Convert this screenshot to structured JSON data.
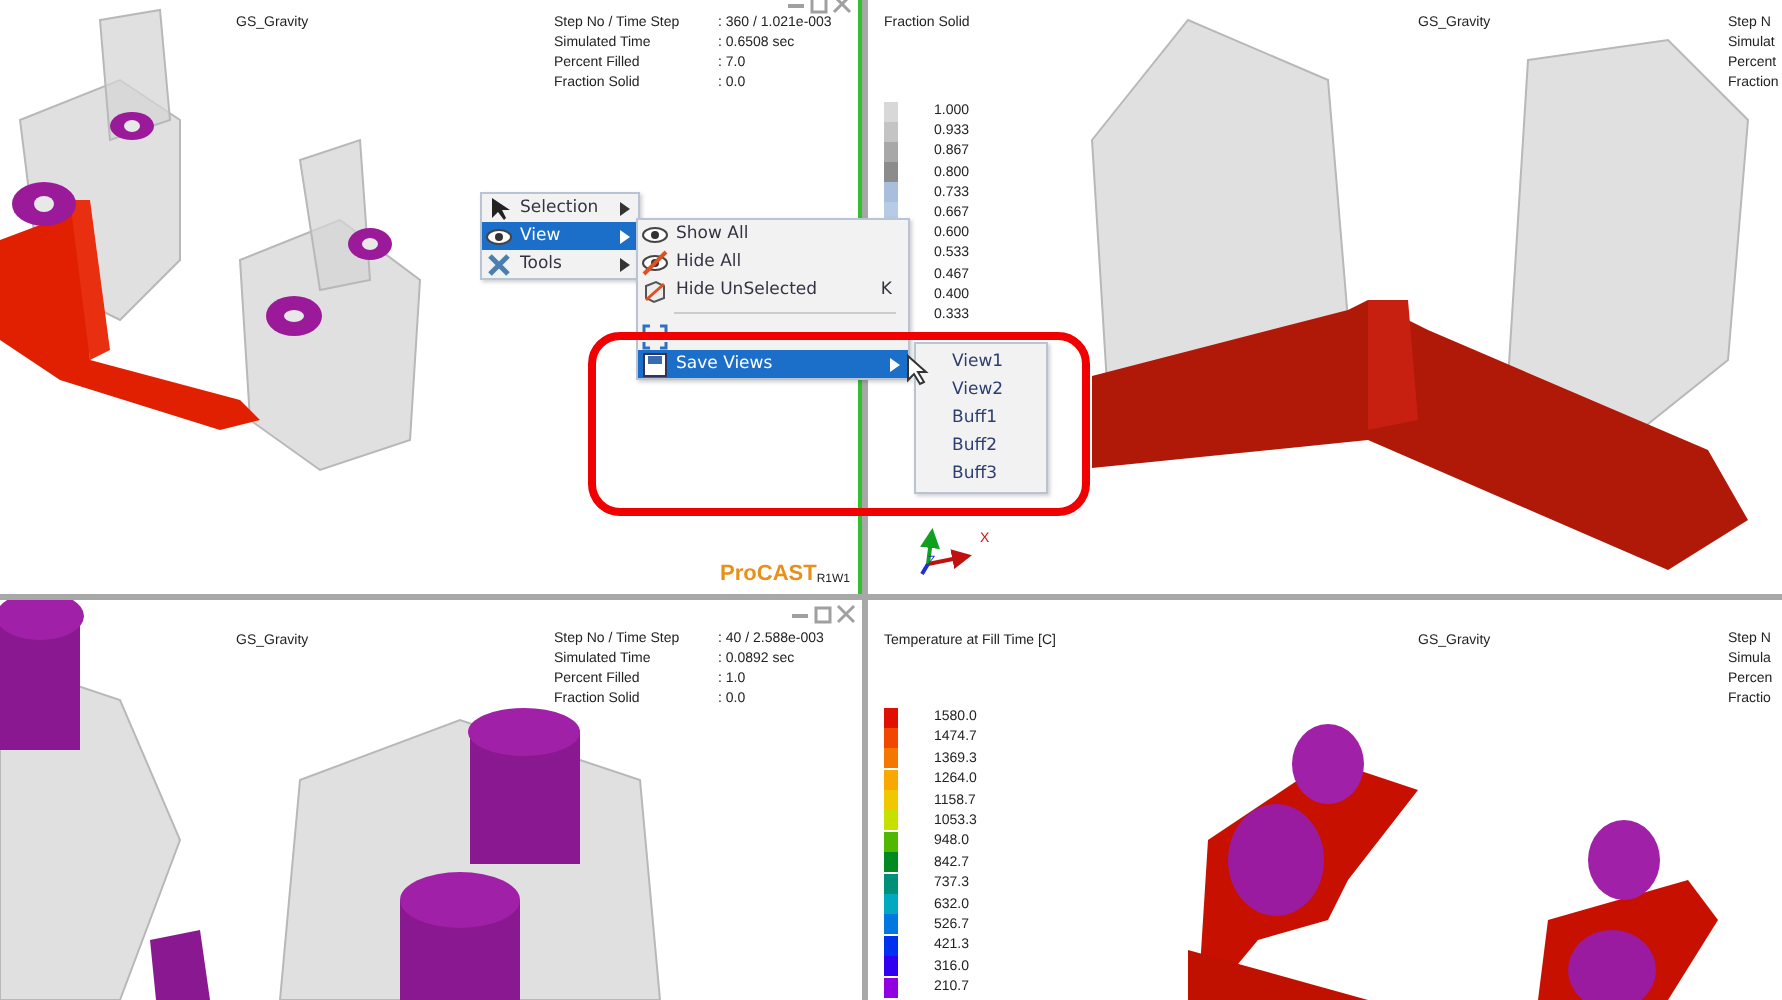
{
  "viewports": [
    {
      "kind": "fill",
      "active": true,
      "title": "GS_Gravity",
      "info": [
        {
          "label": "Step No / Time Step",
          "value": ": 360 / 1.021e-003"
        },
        {
          "label": "Simulated Time",
          "value": ": 0.6508 sec"
        },
        {
          "label": "Percent Filled",
          "value": ": 7.0"
        },
        {
          "label": "Fraction Solid",
          "value": ": 0.0"
        }
      ],
      "logo": "ProCAST",
      "logo_tag": "R1W1"
    },
    {
      "kind": "fraction",
      "active": false,
      "title": "GS_Gravity",
      "info": [
        {
          "label": "Step N"
        },
        {
          "label": "Simulat"
        },
        {
          "label": "Percent"
        },
        {
          "label": "Fraction"
        }
      ],
      "legend": {
        "title": "Fraction Solid",
        "items": [
          {
            "value": "1.000",
            "color": "#d8d8d8"
          },
          {
            "value": "0.933",
            "color": "#c4c4c4"
          },
          {
            "value": "0.867",
            "color": "#a8a8a8"
          },
          {
            "value": "0.800",
            "color": "#8c8c8c"
          },
          {
            "value": "0.733",
            "color": "#a9bedc"
          },
          {
            "value": "0.667",
            "color": "#b8cbe6"
          },
          {
            "value": "0.600"
          },
          {
            "value": "0.533"
          },
          {
            "value": "0.467"
          },
          {
            "value": "0.400"
          },
          {
            "value": "0.333"
          }
        ]
      },
      "axes": {
        "x": "X",
        "z": "Z"
      }
    },
    {
      "kind": "fill_zoom",
      "active": false,
      "title": "GS_Gravity",
      "info": [
        {
          "label": "Step No / Time Step",
          "value": ": 40 / 2.588e-003"
        },
        {
          "label": "Simulated Time",
          "value": ": 0.0892 sec"
        },
        {
          "label": "Percent Filled",
          "value": ": 1.0"
        },
        {
          "label": "Fraction Solid",
          "value": ": 0.0"
        }
      ]
    },
    {
      "kind": "temperature",
      "active": false,
      "title": "GS_Gravity",
      "info": [
        {
          "label": "Step N"
        },
        {
          "label": "Simula"
        },
        {
          "label": "Percen"
        },
        {
          "label": "Fractio"
        }
      ],
      "legend": {
        "title": "Temperature at Fill Time [C]",
        "items": [
          {
            "value": "1580.0",
            "color": "#e01000"
          },
          {
            "value": "1474.7",
            "color": "#f04800"
          },
          {
            "value": "1369.3",
            "color": "#f47800"
          },
          {
            "value": "1264.0",
            "color": "#f8a800"
          },
          {
            "value": "1158.7",
            "color": "#f0c800"
          },
          {
            "value": "1053.3",
            "color": "#c8e000"
          },
          {
            "value": "948.0",
            "color": "#50b800"
          },
          {
            "value": "842.7",
            "color": "#008a20"
          },
          {
            "value": "737.3",
            "color": "#00907a"
          },
          {
            "value": "632.0",
            "color": "#00a8c0"
          },
          {
            "value": "526.7",
            "color": "#0078e0"
          },
          {
            "value": "421.3",
            "color": "#0030f0"
          },
          {
            "value": "316.0",
            "color": "#3000f0"
          },
          {
            "value": "210.7",
            "color": "#9000e0"
          }
        ]
      }
    }
  ],
  "context_menu": {
    "items": [
      {
        "label": "Selection",
        "selected": false
      },
      {
        "label": "View",
        "selected": true
      },
      {
        "label": "Tools",
        "selected": false
      }
    ],
    "submenu": [
      {
        "kind": "item",
        "label": "Show All",
        "selected": false
      },
      {
        "kind": "item",
        "label": "Hide All",
        "selected": false
      },
      {
        "kind": "item",
        "label": "Hide UnSelected",
        "shortcut": "K",
        "selected": false
      },
      {
        "kind": "separator"
      },
      {
        "kind": "obscured",
        "selected": false
      },
      {
        "kind": "item",
        "label": "Save Views",
        "submenu": true,
        "selected": true
      }
    ],
    "views": [
      {
        "label": "View1",
        "selected": false
      },
      {
        "label": "View2",
        "selected": false
      },
      {
        "label": "Buff1",
        "selected": false
      },
      {
        "label": "Buff2",
        "selected": false
      },
      {
        "label": "Buff3",
        "selected": false
      }
    ]
  }
}
